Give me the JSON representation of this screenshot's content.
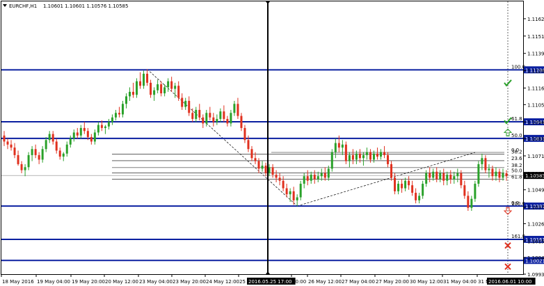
{
  "header": {
    "symbol": "EURCHF,H1",
    "ohlc": "1.10601 1.10601 1.10576 1.10585"
  },
  "colors": {
    "bull": "#2aa12a",
    "bear": "#e0301e",
    "level_line": "#0a1fa0",
    "badge_bg": "#0a1fa0",
    "price_bg": "#000000",
    "check": "#2aa12a",
    "cross": "#e0301e"
  },
  "chart_data": {
    "type": "candlestick",
    "symbol": "EURCHF",
    "timeframe": "H1",
    "ylim": [
      1.0993,
      1.1174
    ],
    "y_ticks": [
      "1.11625",
      "1.11510",
      "1.11395",
      "1.11280",
      "1.11165",
      "1.11055",
      "1.10940",
      "1.10830",
      "1.10715",
      "1.10600",
      "1.10490",
      "1.10375",
      "1.10265",
      "1.10150",
      "1.10040",
      "1.09930"
    ],
    "x_ticks": [
      "18 May 2016",
      "19 May 04:00",
      "19 May 20:00",
      "20 May 12:00",
      "23 May 04:00",
      "23 May 20:00",
      "24 May 12:00",
      "25",
      "2016.05.25 17:00",
      "20:00",
      "26 May 12:00",
      "27 May 04:00",
      "27 May 20:00",
      "30 May 12:00",
      "31 May 04:00",
      "31 M",
      "2016.06.01 10:00"
    ],
    "levels": [
      {
        "label": "1.11286",
        "value": 1.11286
      },
      {
        "label": "1.10941",
        "value": 1.10941
      },
      {
        "label": "1.10831",
        "value": 1.10831
      },
      {
        "label": "1.10382",
        "value": 1.10382
      },
      {
        "label": "1.10161",
        "value": 1.10161
      },
      {
        "label": "1.10021",
        "value": 1.10021
      }
    ],
    "current_price": "1.10585",
    "fib_big": [
      {
        "label": "100.0",
        "value": 1.11286
      },
      {
        "label": "61.8",
        "value": 1.10941
      },
      {
        "label": "50.0",
        "value": 1.10831
      },
      {
        "label": "0.0",
        "value": 1.10382
      },
      {
        "label": "161.8",
        "value": 1.10161
      }
    ],
    "fib_small": [
      {
        "label": "0.0",
        "value": 1.10738
      },
      {
        "label": "38.2",
        "value": 1.10726
      },
      {
        "label": "23.6",
        "value": 1.10683
      },
      {
        "label": "38.2",
        "value": 1.10637
      },
      {
        "label": "50.0",
        "value": 1.10602
      },
      {
        "label": "61.8",
        "value": 1.1056
      },
      {
        "label": "100.0",
        "value": 1.10382
      }
    ],
    "signals": [
      {
        "type": "check",
        "value": 1.112
      },
      {
        "type": "check",
        "value": 1.1095
      },
      {
        "type": "arrow-up",
        "value": 1.1087
      },
      {
        "type": "arrow-down",
        "value": 1.1035
      },
      {
        "type": "cross",
        "value": 1.1012
      },
      {
        "type": "cross",
        "value": 1.0998
      }
    ],
    "candles": [
      [
        1.1085,
        1.1088,
        1.1078,
        1.1081
      ],
      [
        1.1081,
        1.1083,
        1.1076,
        1.1079
      ],
      [
        1.1079,
        1.1082,
        1.1075,
        1.1077
      ],
      [
        1.1077,
        1.108,
        1.107,
        1.1072
      ],
      [
        1.1072,
        1.1075,
        1.1065,
        1.1066
      ],
      [
        1.1066,
        1.1068,
        1.106,
        1.1062
      ],
      [
        1.1062,
        1.1066,
        1.1058,
        1.1064
      ],
      [
        1.1064,
        1.1074,
        1.1062,
        1.1072
      ],
      [
        1.1072,
        1.1078,
        1.1068,
        1.1076
      ],
      [
        1.1076,
        1.1079,
        1.107,
        1.1072
      ],
      [
        1.1072,
        1.1074,
        1.1066,
        1.1069
      ],
      [
        1.1069,
        1.1078,
        1.1067,
        1.1076
      ],
      [
        1.1076,
        1.1084,
        1.1074,
        1.1082
      ],
      [
        1.1082,
        1.1088,
        1.108,
        1.1086
      ],
      [
        1.1086,
        1.1088,
        1.1079,
        1.1081
      ],
      [
        1.1081,
        1.1083,
        1.1073,
        1.1075
      ],
      [
        1.1075,
        1.1077,
        1.1069,
        1.1071
      ],
      [
        1.1071,
        1.1074,
        1.1068,
        1.1073
      ],
      [
        1.1073,
        1.1081,
        1.1071,
        1.1079
      ],
      [
        1.1079,
        1.1085,
        1.1077,
        1.1083
      ],
      [
        1.1083,
        1.1089,
        1.1081,
        1.1087
      ],
      [
        1.1087,
        1.109,
        1.1083,
        1.1085
      ],
      [
        1.1085,
        1.1092,
        1.1083,
        1.109
      ],
      [
        1.109,
        1.1094,
        1.1086,
        1.1088
      ],
      [
        1.1088,
        1.109,
        1.1082,
        1.1084
      ],
      [
        1.1084,
        1.1086,
        1.1079,
        1.1081
      ],
      [
        1.1081,
        1.1089,
        1.1079,
        1.1087
      ],
      [
        1.1087,
        1.1094,
        1.1085,
        1.1092
      ],
      [
        1.1092,
        1.1095,
        1.1088,
        1.109
      ],
      [
        1.109,
        1.1092,
        1.1086,
        1.1091
      ],
      [
        1.1091,
        1.1096,
        1.1089,
        1.1094
      ],
      [
        1.1094,
        1.1099,
        1.1092,
        1.1097
      ],
      [
        1.1097,
        1.1102,
        1.1095,
        1.11
      ],
      [
        1.11,
        1.1104,
        1.1097,
        1.1099
      ],
      [
        1.1099,
        1.1108,
        1.1097,
        1.1106
      ],
      [
        1.1106,
        1.1113,
        1.1103,
        1.1111
      ],
      [
        1.1111,
        1.1117,
        1.1108,
        1.1114
      ],
      [
        1.1114,
        1.112,
        1.111,
        1.1112
      ],
      [
        1.1112,
        1.1123,
        1.111,
        1.1121
      ],
      [
        1.1121,
        1.1127,
        1.1116,
        1.1118
      ],
      [
        1.1118,
        1.1128,
        1.1116,
        1.1126
      ],
      [
        1.1126,
        1.1129,
        1.1118,
        1.112
      ],
      [
        1.112,
        1.1122,
        1.111,
        1.1112
      ],
      [
        1.1112,
        1.1117,
        1.1108,
        1.1115
      ],
      [
        1.1115,
        1.1122,
        1.1113,
        1.1119
      ],
      [
        1.1119,
        1.1121,
        1.1111,
        1.1113
      ],
      [
        1.1113,
        1.1119,
        1.1111,
        1.1117
      ],
      [
        1.1117,
        1.1123,
        1.1114,
        1.1121
      ],
      [
        1.1121,
        1.1124,
        1.1114,
        1.1116
      ],
      [
        1.1116,
        1.112,
        1.111,
        1.1118
      ],
      [
        1.1118,
        1.1121,
        1.1108,
        1.111
      ],
      [
        1.111,
        1.1113,
        1.1102,
        1.1104
      ],
      [
        1.1104,
        1.111,
        1.1102,
        1.1108
      ],
      [
        1.1108,
        1.1111,
        1.1098,
        1.11
      ],
      [
        1.11,
        1.1103,
        1.1094,
        1.1096
      ],
      [
        1.1096,
        1.1104,
        1.1094,
        1.1102
      ],
      [
        1.1102,
        1.1106,
        1.1095,
        1.1097
      ],
      [
        1.1097,
        1.1099,
        1.109,
        1.1093
      ],
      [
        1.1093,
        1.1102,
        1.1091,
        1.11
      ],
      [
        1.11,
        1.1104,
        1.1095,
        1.1097
      ],
      [
        1.1097,
        1.11,
        1.1091,
        1.1094
      ],
      [
        1.1094,
        1.1099,
        1.1092,
        1.1096
      ],
      [
        1.1096,
        1.1103,
        1.1094,
        1.1101
      ],
      [
        1.1101,
        1.1105,
        1.1094,
        1.1096
      ],
      [
        1.1096,
        1.1098,
        1.1091,
        1.1093
      ],
      [
        1.1093,
        1.1102,
        1.1091,
        1.11
      ],
      [
        1.11,
        1.1108,
        1.1098,
        1.1106
      ],
      [
        1.1106,
        1.111,
        1.1096,
        1.1098
      ],
      [
        1.1098,
        1.11,
        1.1088,
        1.109
      ],
      [
        1.109,
        1.1092,
        1.108,
        1.1082
      ],
      [
        1.1082,
        1.1085,
        1.1074,
        1.1076
      ],
      [
        1.1076,
        1.1078,
        1.1068,
        1.107
      ],
      [
        1.107,
        1.1074,
        1.1066,
        1.1068
      ],
      [
        1.1068,
        1.107,
        1.106,
        1.1063
      ],
      [
        1.1063,
        1.1068,
        1.1061,
        1.1065
      ],
      [
        1.1065,
        1.1067,
        1.1058,
        1.106
      ],
      [
        1.106,
        1.1066,
        1.1058,
        1.1064
      ],
      [
        1.1064,
        1.1066,
        1.1057,
        1.1059
      ],
      [
        1.1059,
        1.1062,
        1.1054,
        1.1057
      ],
      [
        1.1057,
        1.106,
        1.1052,
        1.1055
      ],
      [
        1.1055,
        1.1058,
        1.1048,
        1.105
      ],
      [
        1.105,
        1.1053,
        1.1044,
        1.1046
      ],
      [
        1.1046,
        1.105,
        1.1041,
        1.1048
      ],
      [
        1.1048,
        1.1051,
        1.1039,
        1.1042
      ],
      [
        1.1042,
        1.1046,
        1.1038,
        1.1044
      ],
      [
        1.1044,
        1.1055,
        1.1042,
        1.1053
      ],
      [
        1.1053,
        1.106,
        1.105,
        1.1058
      ],
      [
        1.1058,
        1.1062,
        1.1052,
        1.1055
      ],
      [
        1.1055,
        1.1061,
        1.1053,
        1.1059
      ],
      [
        1.1059,
        1.1062,
        1.1053,
        1.1056
      ],
      [
        1.1056,
        1.1061,
        1.1054,
        1.1058
      ],
      [
        1.1058,
        1.1063,
        1.1055,
        1.106
      ],
      [
        1.106,
        1.1064,
        1.1055,
        1.1057
      ],
      [
        1.1057,
        1.1065,
        1.1055,
        1.1063
      ],
      [
        1.1063,
        1.1076,
        1.1061,
        1.1074
      ],
      [
        1.1074,
        1.1083,
        1.107,
        1.108
      ],
      [
        1.108,
        1.1085,
        1.1074,
        1.1077
      ],
      [
        1.1077,
        1.1082,
        1.1072,
        1.1079
      ],
      [
        1.1079,
        1.1081,
        1.1066,
        1.1068
      ],
      [
        1.1068,
        1.1074,
        1.1064,
        1.1072
      ],
      [
        1.1072,
        1.1076,
        1.1066,
        1.1069
      ],
      [
        1.1069,
        1.1075,
        1.1066,
        1.1073
      ],
      [
        1.1073,
        1.1076,
        1.1067,
        1.107
      ],
      [
        1.107,
        1.1074,
        1.1065,
        1.1072
      ],
      [
        1.1072,
        1.1077,
        1.1069,
        1.1074
      ],
      [
        1.1074,
        1.1076,
        1.1067,
        1.1069
      ],
      [
        1.1069,
        1.1075,
        1.1067,
        1.1073
      ],
      [
        1.1073,
        1.1077,
        1.1069,
        1.1071
      ],
      [
        1.1071,
        1.1076,
        1.1069,
        1.1074
      ],
      [
        1.1074,
        1.1078,
        1.107,
        1.1072
      ],
      [
        1.1072,
        1.1074,
        1.1064,
        1.1066
      ],
      [
        1.1066,
        1.1068,
        1.1055,
        1.1057
      ],
      [
        1.1057,
        1.106,
        1.1046,
        1.1048
      ],
      [
        1.1048,
        1.1055,
        1.1046,
        1.1053
      ],
      [
        1.1053,
        1.1056,
        1.1047,
        1.105
      ],
      [
        1.105,
        1.1057,
        1.1048,
        1.1055
      ],
      [
        1.1055,
        1.1058,
        1.1049,
        1.1052
      ],
      [
        1.1052,
        1.1055,
        1.1045,
        1.1047
      ],
      [
        1.1047,
        1.105,
        1.104,
        1.1042
      ],
      [
        1.1042,
        1.1047,
        1.104,
        1.1045
      ],
      [
        1.1045,
        1.1055,
        1.1043,
        1.1053
      ],
      [
        1.1053,
        1.1062,
        1.1051,
        1.106
      ],
      [
        1.106,
        1.1064,
        1.1054,
        1.1057
      ],
      [
        1.1057,
        1.1063,
        1.1055,
        1.1061
      ],
      [
        1.1061,
        1.1064,
        1.1054,
        1.1056
      ],
      [
        1.1056,
        1.1062,
        1.1054,
        1.106
      ],
      [
        1.106,
        1.1063,
        1.1052,
        1.1055
      ],
      [
        1.1055,
        1.1061,
        1.1052,
        1.1059
      ],
      [
        1.1059,
        1.1062,
        1.1053,
        1.1056
      ],
      [
        1.1056,
        1.1061,
        1.1053,
        1.1058
      ],
      [
        1.1058,
        1.1063,
        1.1054,
        1.106
      ],
      [
        1.106,
        1.1062,
        1.105,
        1.1052
      ],
      [
        1.1052,
        1.1055,
        1.1043,
        1.1045
      ],
      [
        1.1045,
        1.1048,
        1.1035,
        1.1037
      ],
      [
        1.1037,
        1.1045,
        1.1035,
        1.1043
      ],
      [
        1.1043,
        1.1055,
        1.1041,
        1.1053
      ],
      [
        1.1053,
        1.1068,
        1.1051,
        1.1066
      ],
      [
        1.1066,
        1.1073,
        1.1062,
        1.107
      ],
      [
        1.107,
        1.1072,
        1.106,
        1.1062
      ],
      [
        1.1062,
        1.1066,
        1.1057,
        1.1063
      ],
      [
        1.1063,
        1.1065,
        1.1055,
        1.1058
      ],
      [
        1.1058,
        1.1064,
        1.1055,
        1.1061
      ],
      [
        1.1061,
        1.1063,
        1.1054,
        1.1057
      ],
      [
        1.1057,
        1.1063,
        1.1055,
        1.106
      ],
      [
        1.106,
        1.1062,
        1.1055,
        1.1058
      ]
    ]
  }
}
